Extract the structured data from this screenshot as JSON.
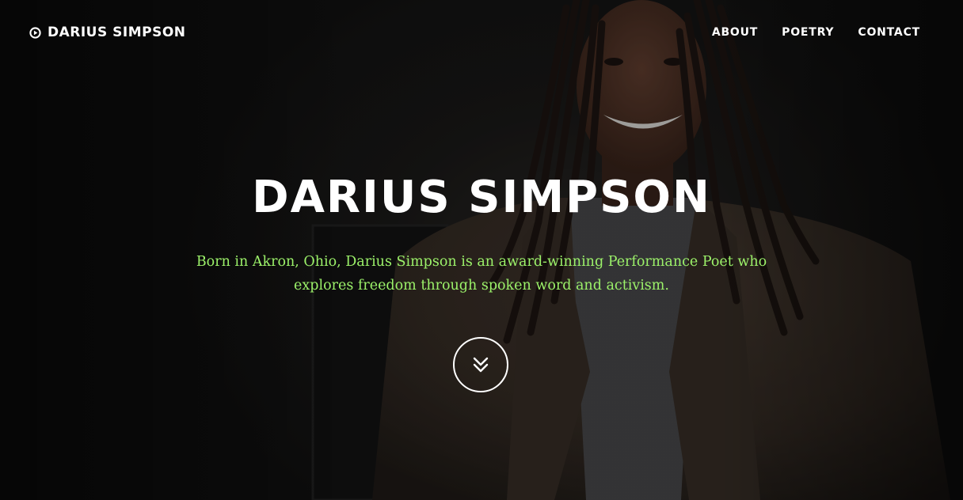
{
  "header": {
    "brand_name": "DARIUS SIMPSON",
    "brand_icon": "play-circle-icon",
    "nav": [
      {
        "label": "ABOUT"
      },
      {
        "label": "POETRY"
      },
      {
        "label": "CONTACT"
      }
    ]
  },
  "hero": {
    "title": "DARIUS SIMPSON",
    "tagline": "Born in Akron, Ohio, Darius Simpson is an award-winning Performance Poet who explores freedom through spoken word and activism.",
    "scroll_icon": "double-chevron-down-icon",
    "background_image": "portrait-photo"
  },
  "colors": {
    "text": "#ffffff",
    "accent": "#9cf26a",
    "background": "#151515"
  }
}
